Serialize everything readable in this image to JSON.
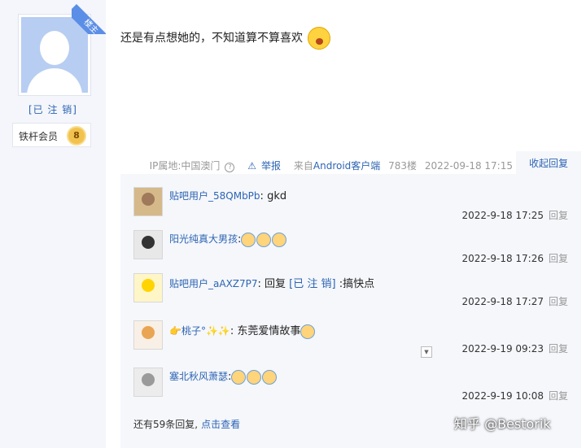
{
  "user": {
    "display_name": "[已 注 销]",
    "ribbon_label": "楼主",
    "level_label": "铁杆会员",
    "level_num": "8"
  },
  "post": {
    "content": "还是有点想她的，不知道算不算喜欢"
  },
  "meta": {
    "ip": "IP属地:中国澳门",
    "help_symbol": "?",
    "report": "举报",
    "report_icon": "⚠",
    "source_prefix": "来自",
    "source_app": "Android客户端",
    "floor": "783楼",
    "datetime": "2022-09-18 17:15"
  },
  "collapse_label": "收起回复",
  "replies": [
    {
      "user": "贴吧用户_58QMbPb",
      "sep": ":",
      "text": " gkd",
      "time": "2022-9-18 17:25",
      "reply_label": "回复"
    },
    {
      "user": "阳光纯真大男孩",
      "sep": ":",
      "text": "",
      "time": "2022-9-18 17:26",
      "reply_label": "回复"
    },
    {
      "user": "贴吧用户_aAXZ7P7",
      "sep": ":",
      "text_prefix": " 回复 ",
      "mention": "[已 注 销]",
      "text_suffix": " :搞快点",
      "time": "2022-9-18 17:27",
      "reply_label": "回复"
    },
    {
      "user": "👉桃子°✨✨",
      "sep": ":",
      "text": " 东莞爱情故事",
      "time": "2022-9-19 09:23",
      "reply_label": "回复"
    },
    {
      "user": "塞北秋风萧瑟",
      "sep": ":",
      "text": "",
      "time": "2022-9-19 10:08",
      "reply_label": "回复"
    }
  ],
  "more": {
    "text": "还有59条回复,",
    "link": "点击查看"
  },
  "watermark": "知乎 @Bestorik",
  "colors": {
    "link_blue": "#2d64b3",
    "panel_bg": "#f5f7fb",
    "left_bg": "#f4f6fb",
    "ribbon": "#5b8ee6"
  }
}
